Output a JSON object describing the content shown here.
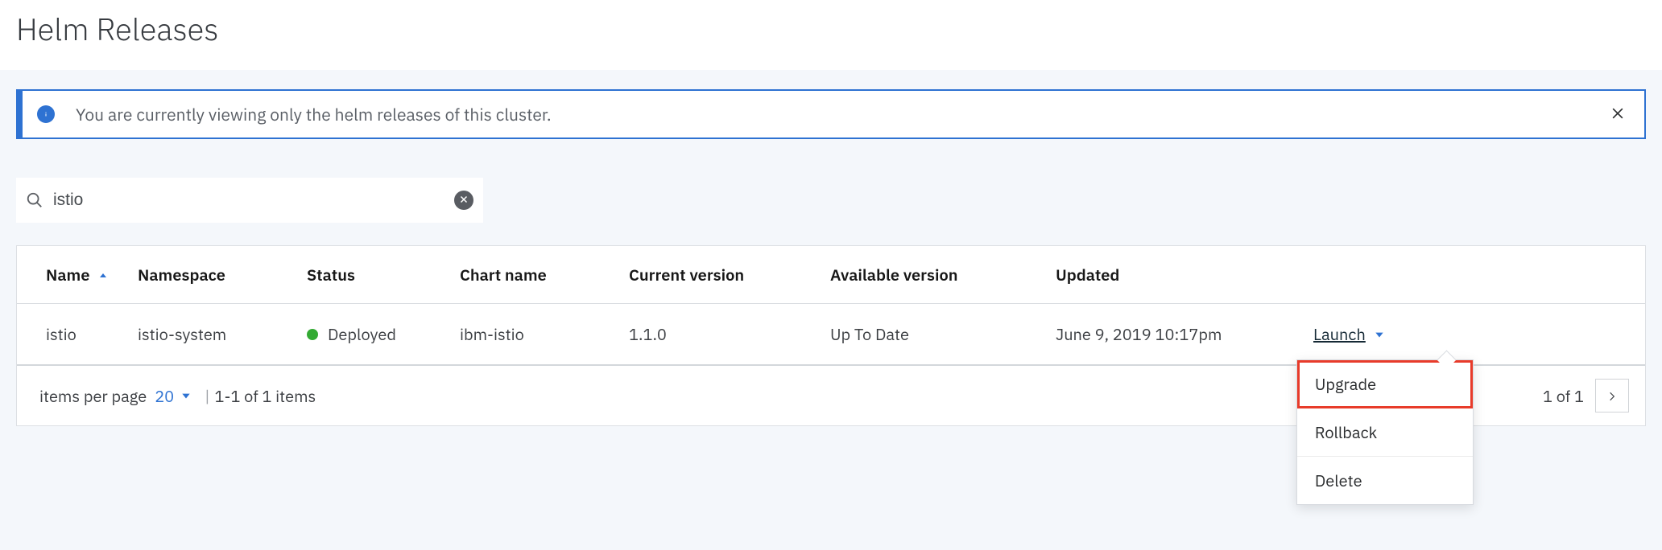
{
  "page_title": "Helm Releases",
  "info_banner": {
    "message": "You are currently viewing only the helm releases of this cluster."
  },
  "search": {
    "value": "istio",
    "placeholder": ""
  },
  "table": {
    "columns": {
      "name": "Name",
      "namespace": "Namespace",
      "status": "Status",
      "chart_name": "Chart name",
      "current_version": "Current version",
      "available_version": "Available version",
      "updated": "Updated"
    },
    "rows": [
      {
        "name": "istio",
        "namespace": "istio-system",
        "status": "Deployed",
        "status_color": "#33aa33",
        "chart_name": "ibm-istio",
        "current_version": "1.1.0",
        "available_version": "Up To Date",
        "updated": "June 9, 2019 10:17pm",
        "action_label": "Launch"
      }
    ]
  },
  "pagination": {
    "items_per_page_label": "items per page",
    "items_per_page_value": "20",
    "range_text": "1-1 of 1 items",
    "page_text": "1 of 1"
  },
  "menu": {
    "items": [
      {
        "label": "Upgrade",
        "highlight": true
      },
      {
        "label": "Rollback",
        "highlight": false
      },
      {
        "label": "Delete",
        "highlight": false
      }
    ]
  }
}
